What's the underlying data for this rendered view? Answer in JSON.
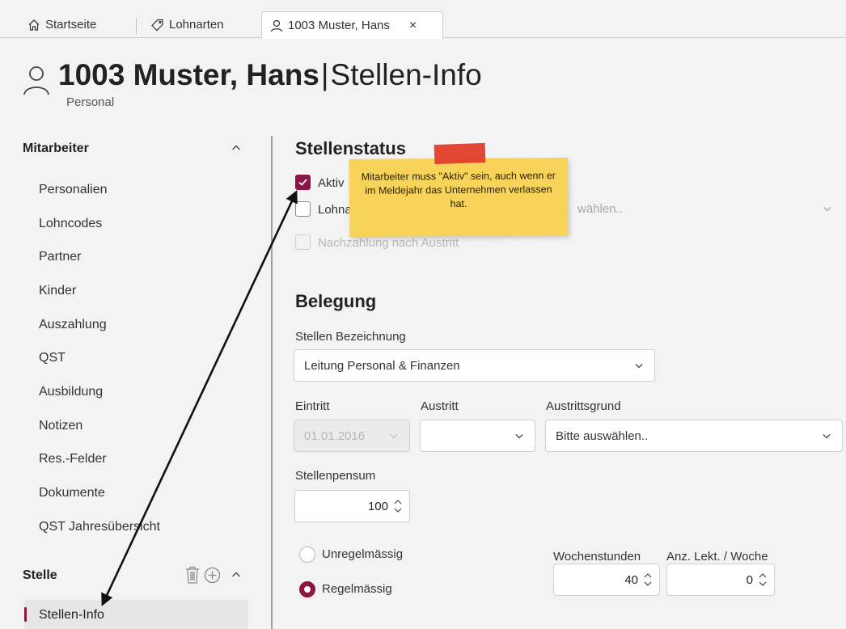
{
  "tabs": [
    {
      "label": "Startseite",
      "icon": "home-icon"
    },
    {
      "label": "Lohnarten",
      "icon": "tag-icon"
    },
    {
      "label": "1003 Muster, Hans",
      "icon": "person-icon",
      "active": true,
      "close": "×"
    }
  ],
  "header": {
    "name": "1003 Muster, Hans",
    "separator": "|",
    "page": "Stellen-Info",
    "subtitle": "Personal"
  },
  "sidebar": {
    "mitarbeiter_title": "Mitarbeiter",
    "items": [
      "Personalien",
      "Lohncodes",
      "Partner",
      "Kinder",
      "Auszahlung",
      "QST",
      "Ausbildung",
      "Notizen",
      "Res.-Felder",
      "Dokumente",
      "QST Jahresübersicht"
    ],
    "stelle_title": "Stelle",
    "selected_item": "Stellen-Info"
  },
  "stellenstatus": {
    "title": "Stellenstatus",
    "aktiv_label": "Aktiv",
    "aktiv_checked": true,
    "lohn_label": "Lohna",
    "lohn_checked": false,
    "lohn_select_placeholder": "wählen..",
    "nachzahlung_label": "Nachzahlung nach Austritt",
    "nachzahlung_checked": false
  },
  "note": {
    "text": "Mitarbeiter muss \"Aktiv\" sein, auch wenn er im Meldejahr das Unternehmen verlassen hat."
  },
  "belegung": {
    "title": "Belegung",
    "bezeichnung_label": "Stellen Bezeichnung",
    "bezeichnung_value": "Leitung Personal & Finanzen",
    "eintritt_label": "Eintritt",
    "eintritt_value": "01.01.2016",
    "austritt_label": "Austritt",
    "austritt_value": "",
    "austrittsgrund_label": "Austrittsgrund",
    "austrittsgrund_value": "Bitte auswählen..",
    "pensum_label": "Stellenpensum",
    "pensum_value": "100",
    "unregelmaessig_label": "Unregelmässig",
    "regelmaessig_label": "Regelmässig",
    "regelmaessig_selected": true,
    "wochenstunden_label": "Wochenstunden",
    "wochenstunden_value": "40",
    "lekt_label": "Anz. Lekt. / Woche",
    "lekt_value": "0"
  },
  "colors": {
    "accent": "#8e1442",
    "note": "#f8d35a",
    "tape": "#e23d2b"
  }
}
